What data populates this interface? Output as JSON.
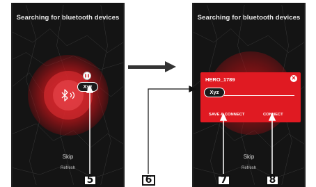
{
  "screens": {
    "left": {
      "title": "Searching for bluetooth devices",
      "device_tag": "Xyz",
      "skip": "Skip",
      "refresh": "Refresh"
    },
    "right": {
      "title": "Searching for bluetooth devices",
      "skip": "Skip",
      "refresh": "Refresh",
      "dialog": {
        "title": "HERO_1789",
        "name_value": "Xyz",
        "close_glyph": "✕",
        "save_connect": "SAVE & CONNECT",
        "connect": "CONNECT"
      }
    }
  },
  "callouts": [
    "5",
    "6",
    "7",
    "8"
  ],
  "colors": {
    "accent": "#e01a22",
    "background": "#141414",
    "arrow": "#333333"
  }
}
